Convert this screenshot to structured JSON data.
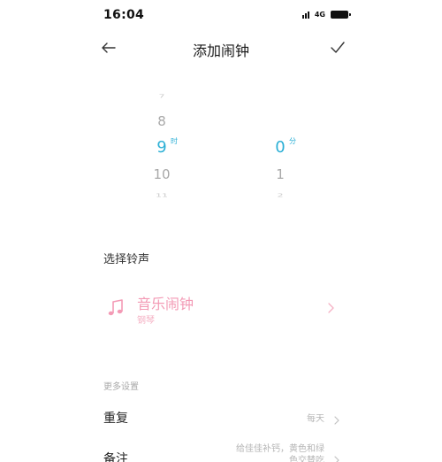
{
  "status_bar": {
    "time": "16:04",
    "network": "4G"
  },
  "header": {
    "title": "添加闹钟",
    "back_icon": "arrow-left-icon",
    "confirm_icon": "checkmark-icon"
  },
  "picker": {
    "hour": {
      "far_above": "7",
      "above": "8",
      "selected": "9",
      "below": "10",
      "far_below": "11",
      "unit": "时"
    },
    "minute": {
      "above": "",
      "selected": "0",
      "below": "1",
      "far_below": "2",
      "unit": "分"
    }
  },
  "ringtone": {
    "section_label": "选择铃声",
    "name": "音乐闹钟",
    "subtitle": "钢琴",
    "icon": "music-note-icon",
    "accent_color": "#f39ab5"
  },
  "more_settings": {
    "label": "更多设置",
    "repeat": {
      "title": "重复",
      "value": "每天"
    },
    "note": {
      "title": "备注",
      "value_line1": "给佳佳补钙，黄色和绿",
      "value_line2": "色交替吃"
    }
  },
  "colors": {
    "selected_picker": "#2db0d6",
    "ringtone_pink": "#f39ab5"
  }
}
